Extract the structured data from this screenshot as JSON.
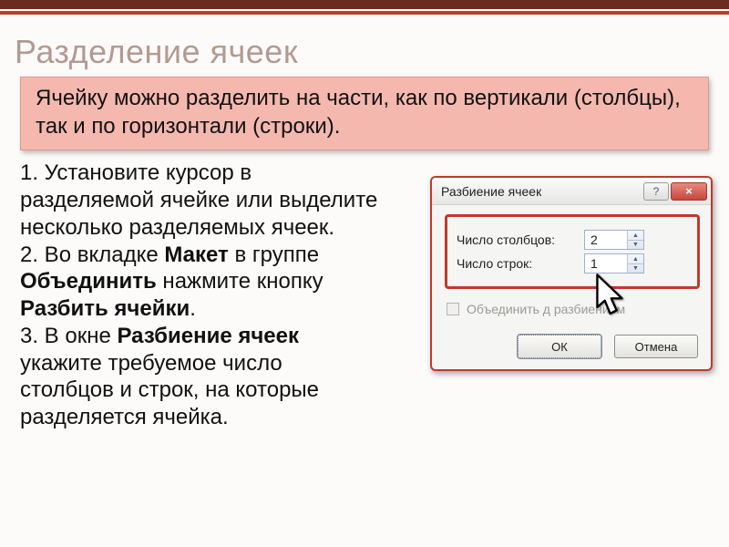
{
  "slide": {
    "title": "Разделение ячеек",
    "intro": "Ячейку можно разделить на части, как по вертикали (столбцы), так и по горизонтали (строки).",
    "step1": "1. Установите курсор в разделяемой ячейке или выделите несколько разделяемых ячеек.",
    "step2a": "2. Во вкладке ",
    "step2b_bold": "Макет",
    "step2c": " в группе ",
    "step2d_bold": "Объединить",
    "step2e": " нажмите кнопку ",
    "step2f_bold": "Разбить ячейки",
    "step2g": ".",
    "step3a": "3. В окне ",
    "step3b_bold": "Разбиение ячеек",
    "step3c": "  укажите требуемое число столбцов и строк, на которые разделяется ячейка."
  },
  "dialog": {
    "title": "Разбиение ячеек",
    "help_tooltip": "?",
    "close_tooltip": "×",
    "cols_label": "Число столбцов:",
    "cols_value": "2",
    "rows_label": "Число строк:",
    "rows_value": "1",
    "checkbox_label": "Объединить            д разбиением",
    "ok_label": "ОК",
    "cancel_label": "Отмена"
  }
}
